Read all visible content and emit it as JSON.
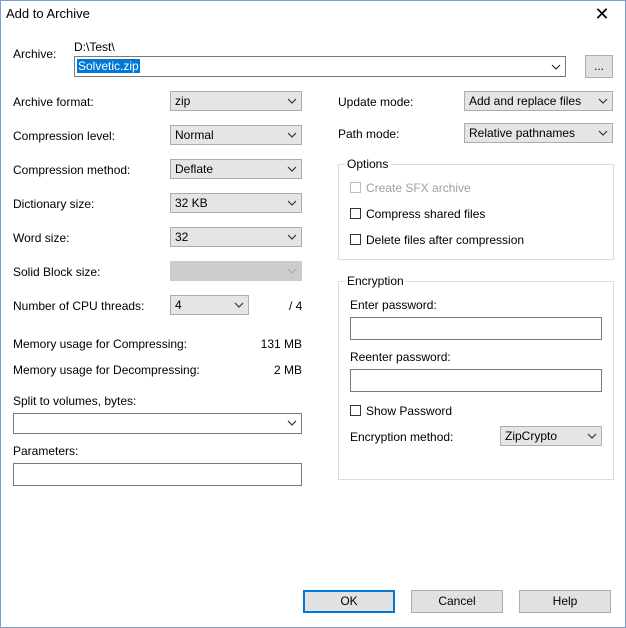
{
  "window": {
    "title": "Add to Archive",
    "close_glyph": "✕"
  },
  "archive": {
    "label": "Archive:",
    "path": "D:\\Test\\",
    "filename": "Solvetic.zip",
    "browse_label": "..."
  },
  "left": {
    "archive_format": {
      "label": "Archive format:",
      "value": "zip"
    },
    "compression_level": {
      "label": "Compression level:",
      "value": "Normal"
    },
    "compression_method": {
      "label": "Compression method:",
      "value": "Deflate"
    },
    "dictionary_size": {
      "label": "Dictionary size:",
      "value": "32 KB"
    },
    "word_size": {
      "label": "Word size:",
      "value": "32"
    },
    "solid_block_size": {
      "label": "Solid Block size:",
      "value": ""
    },
    "cpu_threads": {
      "label": "Number of CPU threads:",
      "value": "4",
      "total": "/ 4"
    },
    "mem_compress": {
      "label": "Memory usage for Compressing:",
      "value": "131 MB"
    },
    "mem_decompress": {
      "label": "Memory usage for Decompressing:",
      "value": "2 MB"
    },
    "split": {
      "label": "Split to volumes, bytes:",
      "value": ""
    },
    "parameters": {
      "label": "Parameters:",
      "value": ""
    }
  },
  "right": {
    "update_mode": {
      "label": "Update mode:",
      "value": "Add and replace files"
    },
    "path_mode": {
      "label": "Path mode:",
      "value": "Relative pathnames"
    },
    "options": {
      "legend": "Options",
      "create_sfx": "Create SFX archive",
      "compress_shared": "Compress shared files",
      "delete_after": "Delete files after compression"
    },
    "encryption": {
      "legend": "Encryption",
      "enter_password": "Enter password:",
      "reenter_password": "Reenter password:",
      "show_password": "Show Password",
      "method_label": "Encryption method:",
      "method_value": "ZipCrypto"
    }
  },
  "buttons": {
    "ok": "OK",
    "cancel": "Cancel",
    "help": "Help"
  }
}
